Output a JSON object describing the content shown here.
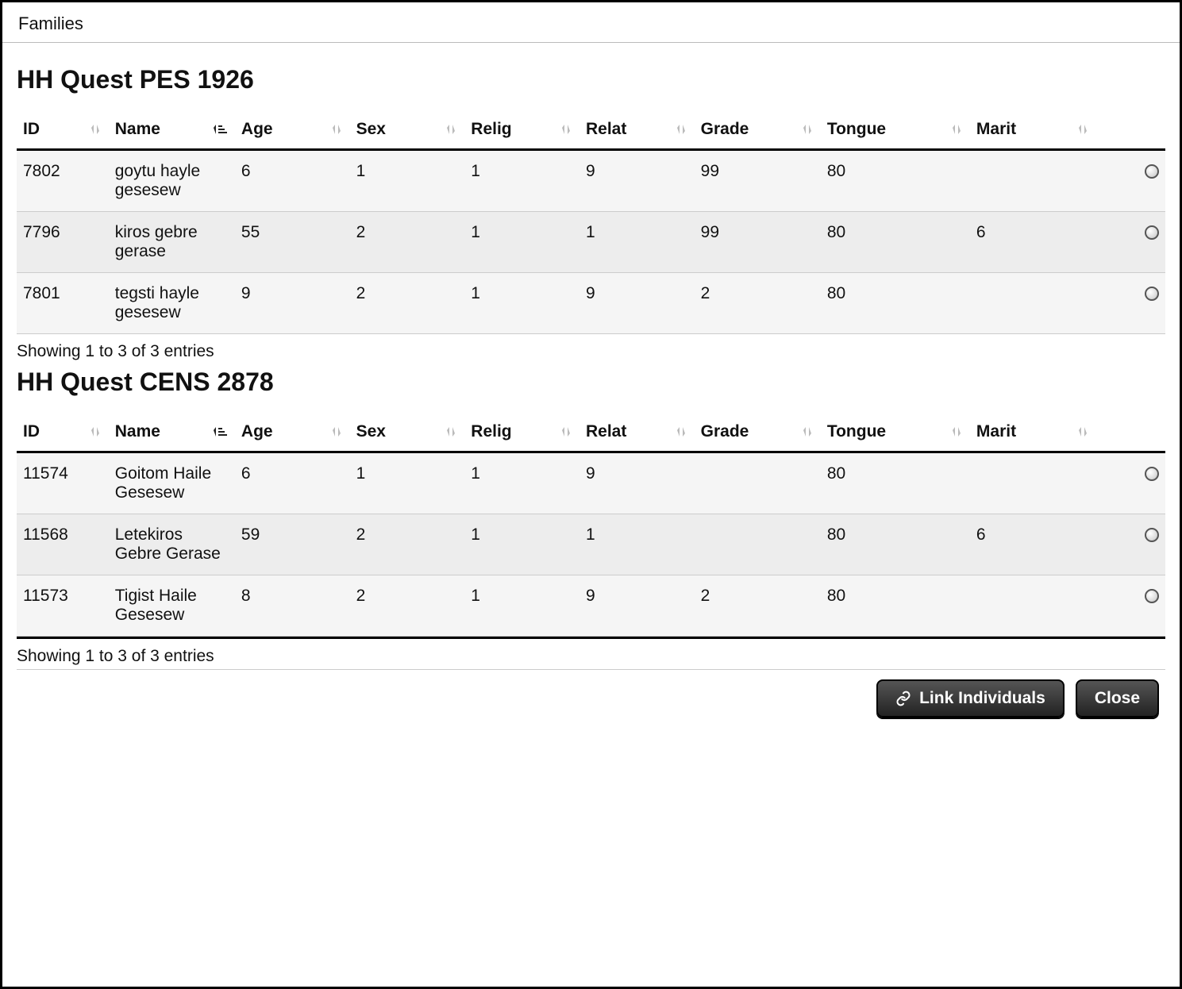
{
  "window": {
    "title": "Families"
  },
  "tables": [
    {
      "title": "HH Quest PES 1926",
      "columns": [
        "ID",
        "Name",
        "Age",
        "Sex",
        "Relig",
        "Relat",
        "Grade",
        "Tongue",
        "Marit"
      ],
      "rows": [
        {
          "id": "7802",
          "name": "goytu hayle gesesew",
          "age": "6",
          "sex": "1",
          "relig": "1",
          "relat": "9",
          "grade": "99",
          "tongue": "80",
          "marit": ""
        },
        {
          "id": "7796",
          "name": "kiros gebre gerase",
          "age": "55",
          "sex": "2",
          "relig": "1",
          "relat": "1",
          "grade": "99",
          "tongue": "80",
          "marit": "6"
        },
        {
          "id": "7801",
          "name": "tegsti hayle gesesew",
          "age": "9",
          "sex": "2",
          "relig": "1",
          "relat": "9",
          "grade": "2",
          "tongue": "80",
          "marit": ""
        }
      ],
      "info": "Showing 1 to 3 of 3 entries"
    },
    {
      "title": "HH Quest CENS 2878",
      "columns": [
        "ID",
        "Name",
        "Age",
        "Sex",
        "Relig",
        "Relat",
        "Grade",
        "Tongue",
        "Marit"
      ],
      "rows": [
        {
          "id": "11574",
          "name": "Goitom Haile Gesesew",
          "age": "6",
          "sex": "1",
          "relig": "1",
          "relat": "9",
          "grade": "",
          "tongue": "80",
          "marit": ""
        },
        {
          "id": "11568",
          "name": "Letekiros Gebre Gerase",
          "age": "59",
          "sex": "2",
          "relig": "1",
          "relat": "1",
          "grade": "",
          "tongue": "80",
          "marit": "6"
        },
        {
          "id": "11573",
          "name": "Tigist Haile Gesesew",
          "age": "8",
          "sex": "2",
          "relig": "1",
          "relat": "9",
          "grade": "2",
          "tongue": "80",
          "marit": ""
        }
      ],
      "info": "Showing 1 to 3 of 3 entries"
    }
  ],
  "footer": {
    "link_label": "Link Individuals",
    "close_label": "Close"
  }
}
